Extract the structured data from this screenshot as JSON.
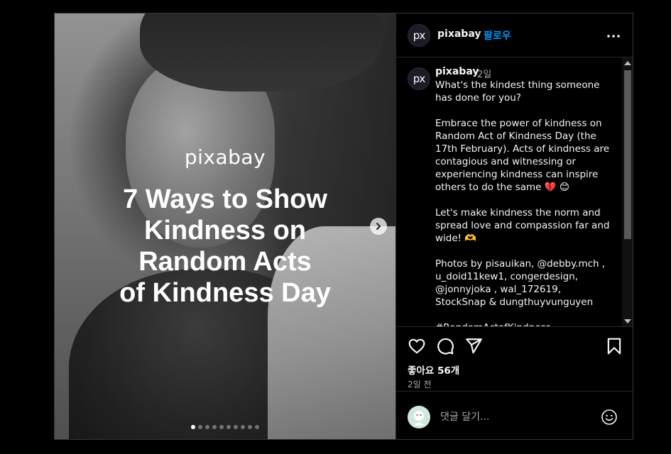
{
  "account": {
    "avatar_text": "px",
    "username": "pixabay",
    "separator": "·",
    "follow_label": "팔로우"
  },
  "media": {
    "brand": "pixabay",
    "headline": "7 Ways to Show\nKindness on\nRandom Acts\nof Kindness Day",
    "slide_count": 10,
    "current_slide": 1
  },
  "caption": {
    "username": "pixabay",
    "time": "2일",
    "text": "What's the kindest thing someone has done for you?\n\nEmbrace the power of kindness on Random Act of Kindness Day (the 17th February). Acts of kindness are contagious and witnessing or experiencing kindness can inspire others to do the same 💔 😊\n\nLet's make kindness the norm and spread love and compassion far and wide! 🫶\n\nPhotos by pisauikan, @debby.mch , u_doid11kew1, congerdesign, @jonnyjoka , wal_172619, StockSnap & dungthuyvunguyen\n\n#RandomActofKindness"
  },
  "stats": {
    "likes": "좋아요 56개",
    "date": "2일 전"
  },
  "comment": {
    "placeholder": "댓글 달기..."
  },
  "icons": [
    "more-icon",
    "chevron-right-icon",
    "heart-icon",
    "comment-icon",
    "share-icon",
    "bookmark-icon",
    "emoji-icon"
  ],
  "colors": {
    "accent": "#0095f6",
    "background": "#000000",
    "text": "#f5f5f5",
    "muted": "#a8a8a8"
  }
}
